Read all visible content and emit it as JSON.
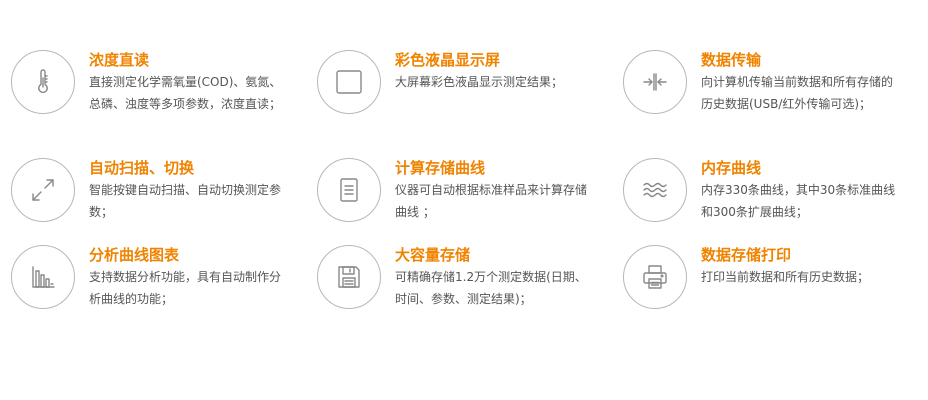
{
  "features": [
    {
      "icon": "thermometer-icon",
      "title": "浓度直读",
      "description": "直接测定化学需氧量(COD)、氨氮、总磷、浊度等多项参数，浓度直读；"
    },
    {
      "icon": "lcd-screen-icon",
      "title": "彩色液晶显示屏",
      "description": "大屏幕彩色液晶显示测定结果；"
    },
    {
      "icon": "data-transfer-icon",
      "title": "数据传输",
      "description": "向计算机传输当前数据和所有存储的历史数据(USB/红外传输可选)；"
    },
    {
      "icon": "scan-switch-icon",
      "title": "自动扫描、切换",
      "description": "智能按键自动扫描、自动切换测定参数；"
    },
    {
      "icon": "curve-document-icon",
      "title": "计算存储曲线",
      "description": "仪器可自动根据标准样品来计算存储曲线 ；"
    },
    {
      "icon": "memory-curve-icon",
      "title": "内存曲线",
      "description": "内存330条曲线，其中30条标准曲线和300条扩展曲线；"
    },
    {
      "icon": "bar-chart-icon",
      "title": "分析曲线图表",
      "description": "支持数据分析功能，具有自动制作分析曲线的功能；"
    },
    {
      "icon": "floppy-disk-icon",
      "title": "大容量存储",
      "description": "可精确存储1.2万个测定数据(日期、时间、参数、测定结果)；"
    },
    {
      "icon": "printer-icon",
      "title": "数据存储打印",
      "description": "打印当前数据和所有历史数据；"
    }
  ],
  "colors": {
    "accent": "#f08300",
    "text": "#555555",
    "icon_stroke": "#888888",
    "circle_border": "#b8b8b8"
  }
}
